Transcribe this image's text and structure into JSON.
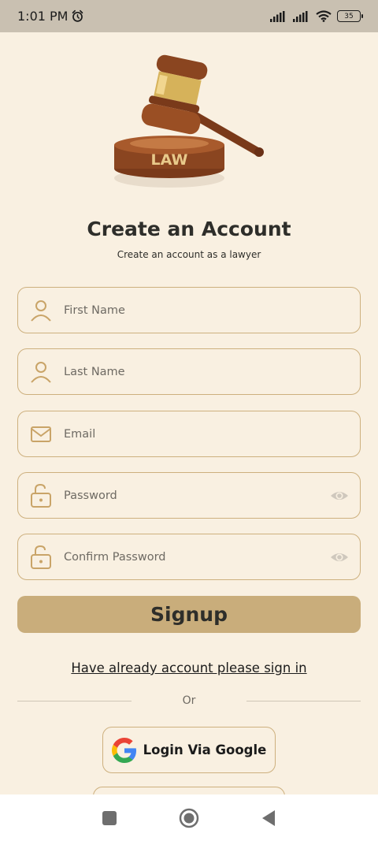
{
  "status_bar": {
    "time": "1:01 PM",
    "battery": "35",
    "icons": [
      "alarm-icon",
      "signal-icon",
      "signal-icon",
      "wifi-icon",
      "battery-icon"
    ]
  },
  "logo": {
    "text": "LAW",
    "icon": "gavel-icon"
  },
  "header": {
    "title": "Create an Account",
    "subtitle": "Create an account as a lawyer"
  },
  "form": {
    "first_name": {
      "placeholder": "First Name",
      "icon": "user-icon"
    },
    "last_name": {
      "placeholder": "Last Name",
      "icon": "user-icon"
    },
    "email": {
      "placeholder": "Email",
      "icon": "mail-icon"
    },
    "password": {
      "placeholder": "Password",
      "icon": "lock-icon",
      "toggle_icon": "eye-icon"
    },
    "confirm_password": {
      "placeholder": "Confirm Password",
      "icon": "lock-icon",
      "toggle_icon": "eye-icon"
    }
  },
  "signup_label": "Signup",
  "signin_link": "Have already account please sign in",
  "or_label": "Or",
  "google_label": "Login Via Google",
  "nav": [
    "recents-icon",
    "home-icon",
    "back-icon"
  ],
  "colors": {
    "background": "#f9f0e1",
    "accent": "#c9ad7b",
    "field_border": "#cdb07e",
    "icon": "#c9a468",
    "text": "#2e2e2a"
  }
}
